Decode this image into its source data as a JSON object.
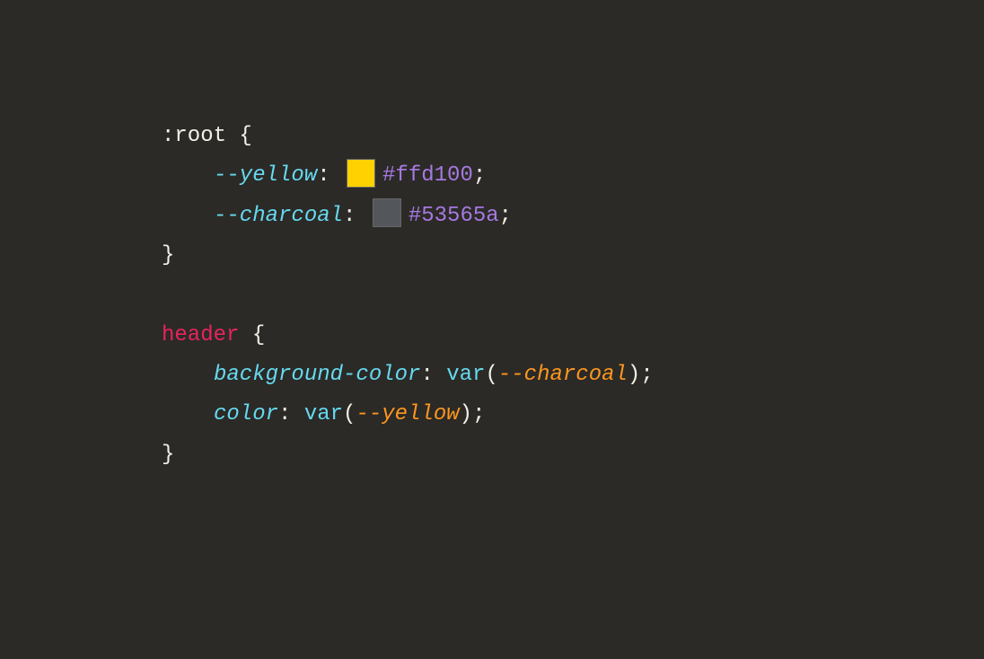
{
  "code": {
    "root_selector": ":root",
    "brace_open": " {",
    "brace_close": "}",
    "var_yellow_name": "--yellow",
    "var_yellow_value": "#ffd100",
    "var_charcoal_name": "--charcoal",
    "var_charcoal_value": "#53565a",
    "header_selector": "header",
    "bg_prop": "background-color",
    "color_prop": "color",
    "var_func": "var",
    "var_charcoal_ref": "--charcoal",
    "var_yellow_ref": "--yellow",
    "colon_space": ": ",
    "semicolon": ";",
    "paren_open": "(",
    "paren_close": ")",
    "swatch_colors": {
      "yellow": "#ffd100",
      "charcoal": "#53565a"
    }
  }
}
